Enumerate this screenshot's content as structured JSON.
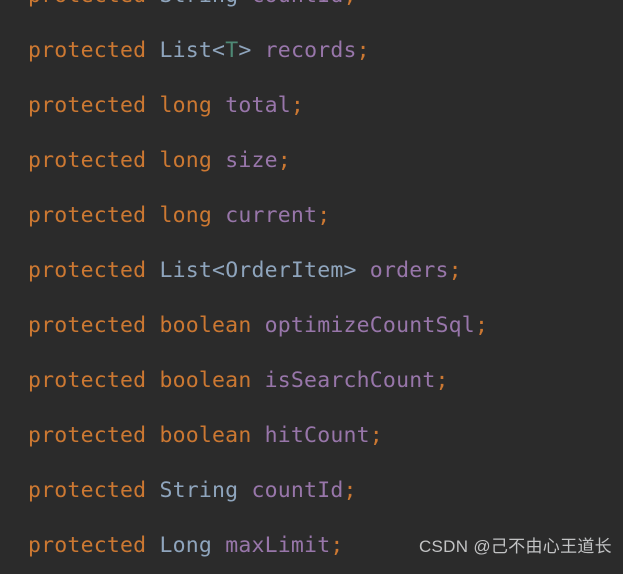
{
  "editor": {
    "language": "java",
    "theme": "darcula",
    "background_color": "#2b2b2b",
    "colors": {
      "keyword": "#cc7832",
      "type": "#8fa5bd",
      "generic_param": "#4e8975",
      "field": "#9876aa",
      "punctuation": "#cc7832"
    },
    "lines": [
      {
        "clipped": true,
        "tokens": [
          {
            "text": "protected",
            "kind": "keyword"
          },
          {
            "text": " ",
            "kind": "plain"
          },
          {
            "text": "String",
            "kind": "type"
          },
          {
            "text": " ",
            "kind": "plain"
          },
          {
            "text": "countId",
            "kind": "field"
          },
          {
            "text": ";",
            "kind": "punctuation"
          }
        ]
      },
      {
        "clipped": false,
        "tokens": [
          {
            "text": "protected",
            "kind": "keyword"
          },
          {
            "text": " ",
            "kind": "plain"
          },
          {
            "text": "List",
            "kind": "type"
          },
          {
            "text": "<",
            "kind": "angle"
          },
          {
            "text": "T",
            "kind": "generic_param"
          },
          {
            "text": ">",
            "kind": "angle"
          },
          {
            "text": " ",
            "kind": "plain"
          },
          {
            "text": "records",
            "kind": "field"
          },
          {
            "text": ";",
            "kind": "punctuation"
          }
        ]
      },
      {
        "clipped": false,
        "tokens": [
          {
            "text": "protected",
            "kind": "keyword"
          },
          {
            "text": " ",
            "kind": "plain"
          },
          {
            "text": "long",
            "kind": "keyword"
          },
          {
            "text": " ",
            "kind": "plain"
          },
          {
            "text": "total",
            "kind": "field"
          },
          {
            "text": ";",
            "kind": "punctuation"
          }
        ]
      },
      {
        "clipped": false,
        "tokens": [
          {
            "text": "protected",
            "kind": "keyword"
          },
          {
            "text": " ",
            "kind": "plain"
          },
          {
            "text": "long",
            "kind": "keyword"
          },
          {
            "text": " ",
            "kind": "plain"
          },
          {
            "text": "size",
            "kind": "field"
          },
          {
            "text": ";",
            "kind": "punctuation"
          }
        ]
      },
      {
        "clipped": false,
        "tokens": [
          {
            "text": "protected",
            "kind": "keyword"
          },
          {
            "text": " ",
            "kind": "plain"
          },
          {
            "text": "long",
            "kind": "keyword"
          },
          {
            "text": " ",
            "kind": "plain"
          },
          {
            "text": "current",
            "kind": "field"
          },
          {
            "text": ";",
            "kind": "punctuation"
          }
        ]
      },
      {
        "clipped": false,
        "tokens": [
          {
            "text": "protected",
            "kind": "keyword"
          },
          {
            "text": " ",
            "kind": "plain"
          },
          {
            "text": "List",
            "kind": "type"
          },
          {
            "text": "<",
            "kind": "angle"
          },
          {
            "text": "OrderItem",
            "kind": "type"
          },
          {
            "text": ">",
            "kind": "angle"
          },
          {
            "text": " ",
            "kind": "plain"
          },
          {
            "text": "orders",
            "kind": "field"
          },
          {
            "text": ";",
            "kind": "punctuation"
          }
        ]
      },
      {
        "clipped": false,
        "tokens": [
          {
            "text": "protected",
            "kind": "keyword"
          },
          {
            "text": " ",
            "kind": "plain"
          },
          {
            "text": "boolean",
            "kind": "keyword"
          },
          {
            "text": " ",
            "kind": "plain"
          },
          {
            "text": "optimizeCountSql",
            "kind": "field"
          },
          {
            "text": ";",
            "kind": "punctuation"
          }
        ]
      },
      {
        "clipped": false,
        "tokens": [
          {
            "text": "protected",
            "kind": "keyword"
          },
          {
            "text": " ",
            "kind": "plain"
          },
          {
            "text": "boolean",
            "kind": "keyword"
          },
          {
            "text": " ",
            "kind": "plain"
          },
          {
            "text": "isSearchCount",
            "kind": "field"
          },
          {
            "text": ";",
            "kind": "punctuation"
          }
        ]
      },
      {
        "clipped": false,
        "tokens": [
          {
            "text": "protected",
            "kind": "keyword"
          },
          {
            "text": " ",
            "kind": "plain"
          },
          {
            "text": "boolean",
            "kind": "keyword"
          },
          {
            "text": " ",
            "kind": "plain"
          },
          {
            "text": "hitCount",
            "kind": "field"
          },
          {
            "text": ";",
            "kind": "punctuation"
          }
        ]
      },
      {
        "clipped": false,
        "tokens": [
          {
            "text": "protected",
            "kind": "keyword"
          },
          {
            "text": " ",
            "kind": "plain"
          },
          {
            "text": "String",
            "kind": "type"
          },
          {
            "text": " ",
            "kind": "plain"
          },
          {
            "text": "countId",
            "kind": "field"
          },
          {
            "text": ";",
            "kind": "punctuation"
          }
        ]
      },
      {
        "clipped": false,
        "tokens": [
          {
            "text": "protected",
            "kind": "keyword"
          },
          {
            "text": " ",
            "kind": "plain"
          },
          {
            "text": "Long",
            "kind": "type"
          },
          {
            "text": " ",
            "kind": "plain"
          },
          {
            "text": "maxLimit",
            "kind": "field"
          },
          {
            "text": ";",
            "kind": "punctuation"
          }
        ]
      }
    ]
  },
  "watermark": {
    "text": "CSDN @己不由心王道长"
  }
}
